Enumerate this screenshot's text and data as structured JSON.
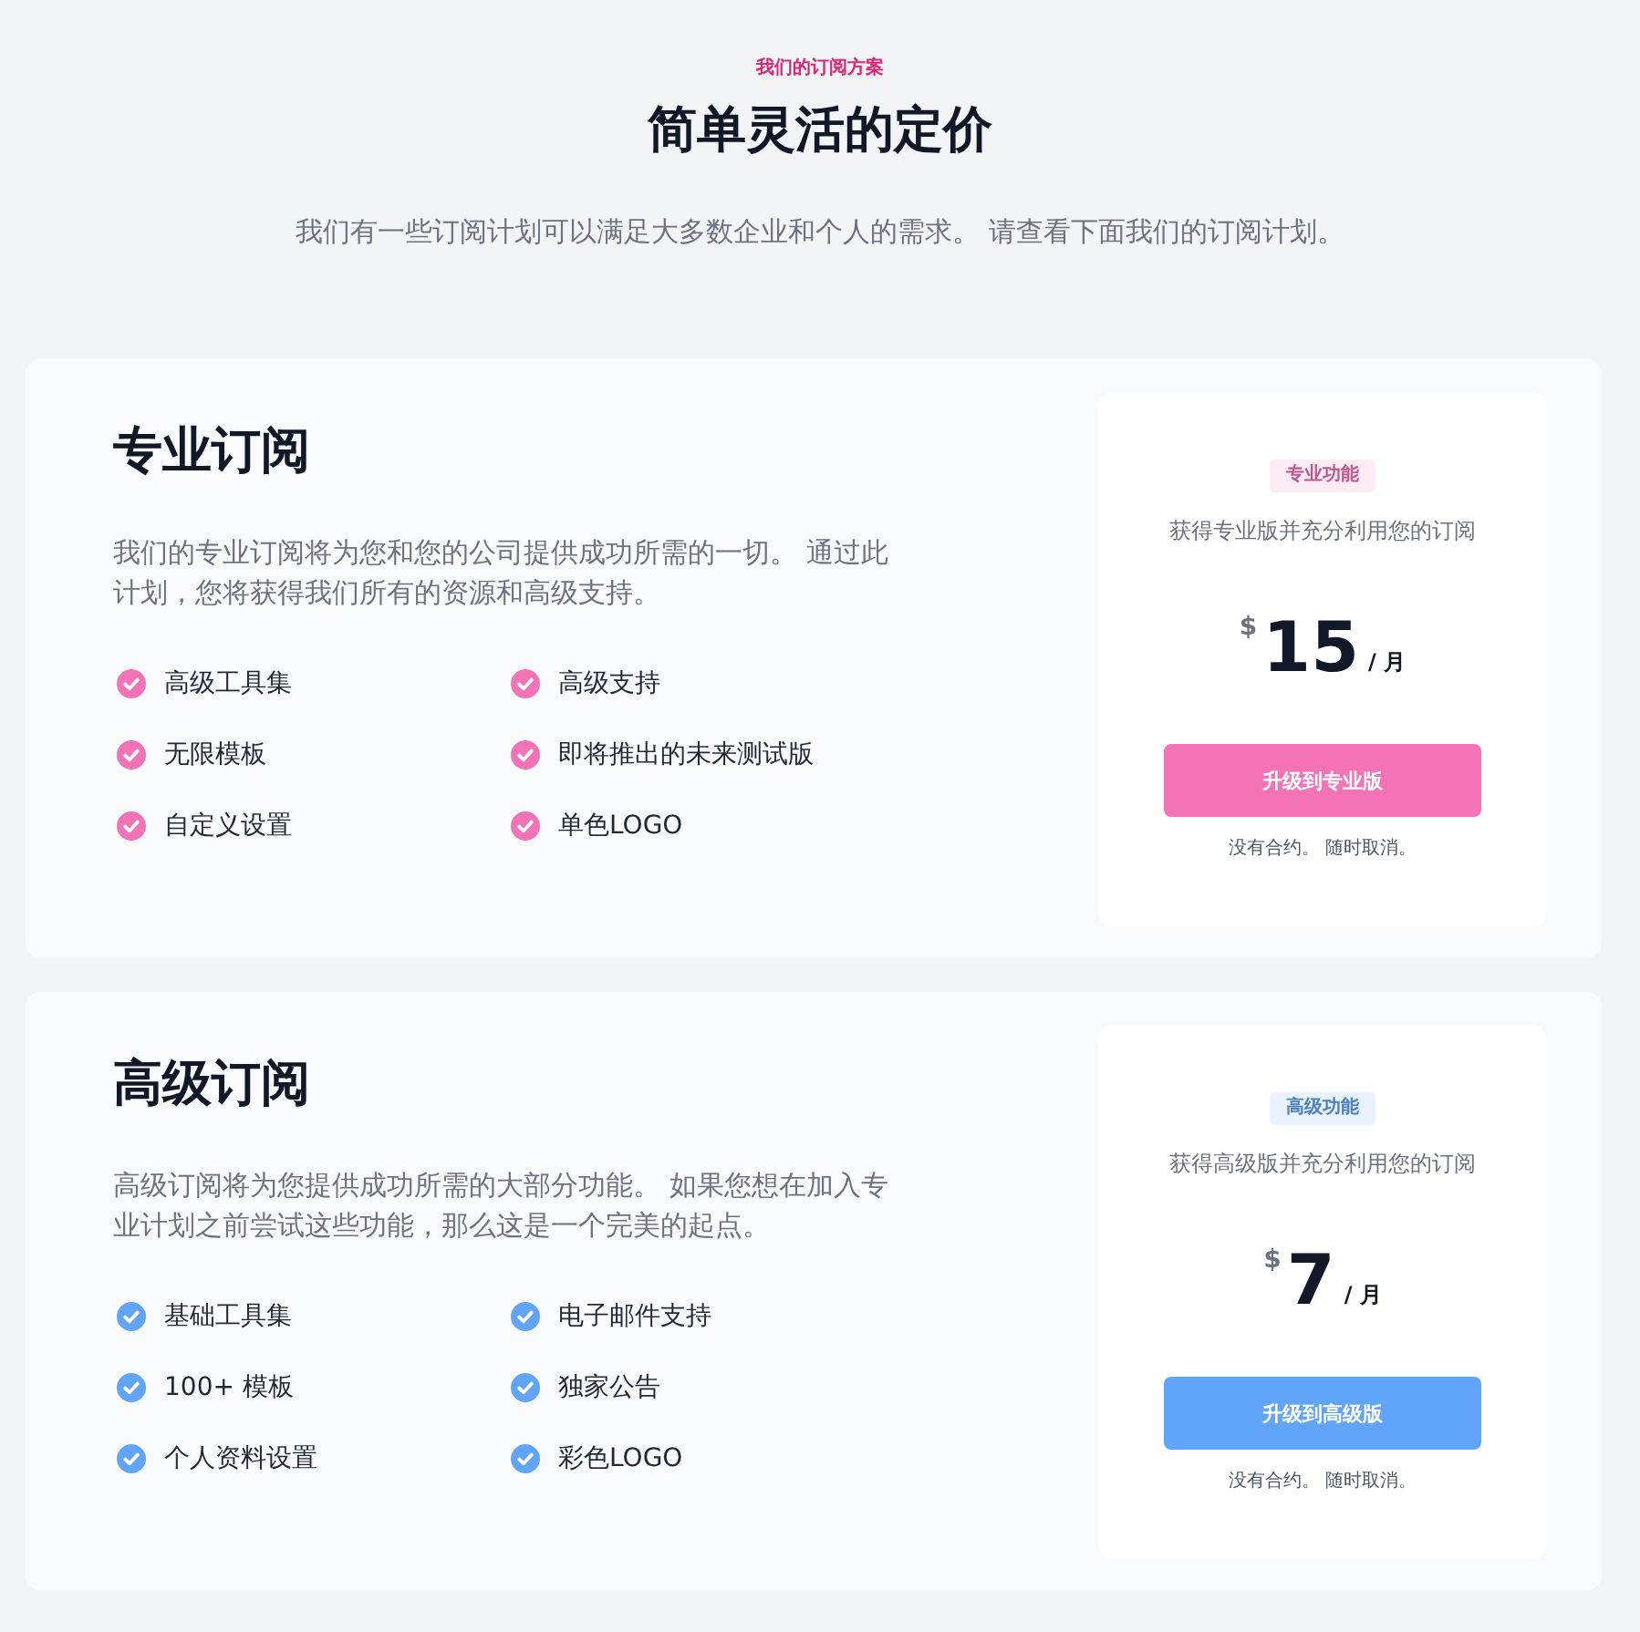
{
  "header": {
    "eyebrow": "我们的订阅方案",
    "title": "简单灵活的定价",
    "subtitle": "我们有一些订阅计划可以满足大多数企业和个人的需求。 请查看下面我们的订阅计划。"
  },
  "plans": [
    {
      "title": "专业订阅",
      "description": "我们的专业订阅将为您和您的公司提供成功所需的一切。 通过此计划，您将获得我们所有的资源和高级支持。",
      "features": [
        "高级工具集",
        "高级支持",
        "无限模板",
        "即将推出的未来测试版",
        "自定义设置",
        "单色LOGO"
      ],
      "color": "#f472b6",
      "badge": "专业功能",
      "tagline": "获得专业版并充分利用您的订阅",
      "currency": "$",
      "price": "15",
      "period": "/ 月",
      "button": "升级到专业版",
      "note": "没有合约。 随时取消。"
    },
    {
      "title": "高级订阅",
      "description": "高级订阅将为您提供成功所需的大部分功能。 如果您想在加入专业计划之前尝试这些功能，那么这是一个完美的起点。",
      "features": [
        "基础工具集",
        "电子邮件支持",
        "100+ 模板",
        "独家公告",
        "个人资料设置",
        "彩色LOGO"
      ],
      "color": "#60a5fa",
      "badge": "高级功能",
      "tagline": "获得高级版并充分利用您的订阅",
      "currency": "$",
      "price": "7",
      "period": "/ 月",
      "button": "升级到高级版",
      "note": "没有合约。 随时取消。"
    }
  ]
}
